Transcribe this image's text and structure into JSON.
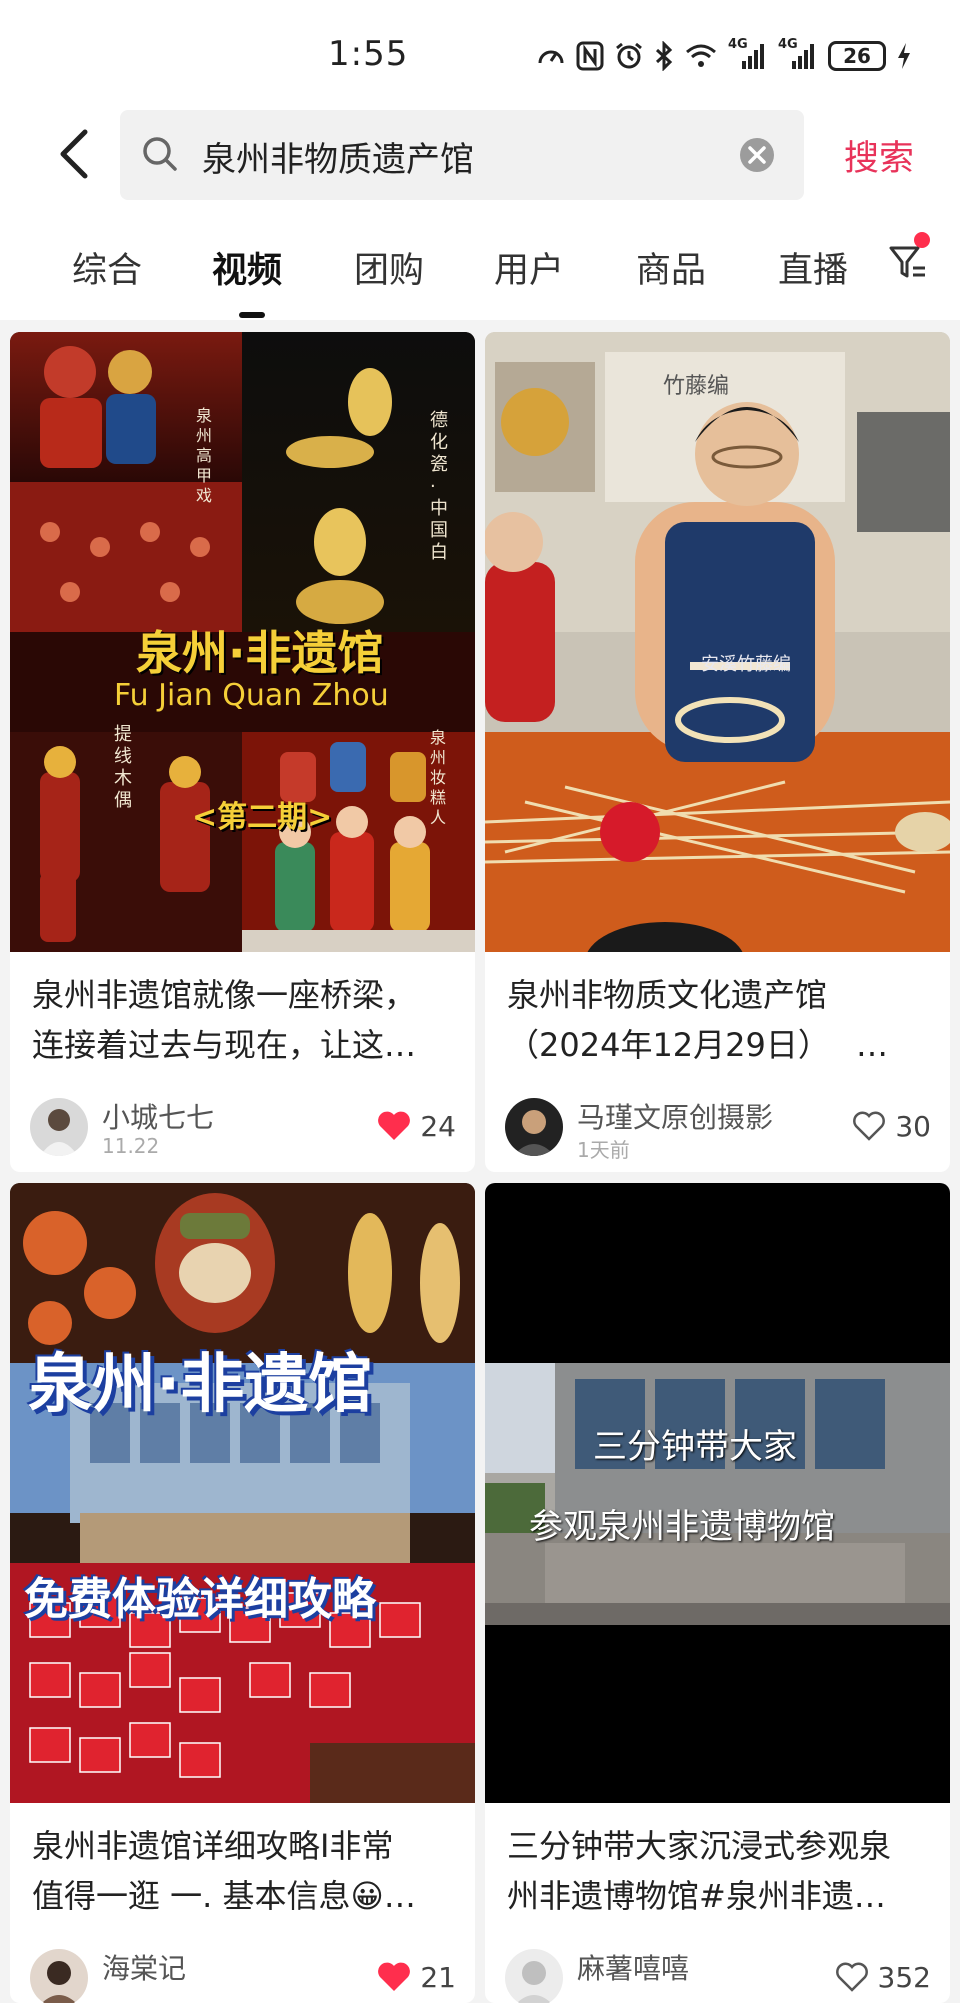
{
  "status_bar": {
    "time": "1:55",
    "battery": "26",
    "signal_labels": [
      "4G",
      "4G"
    ],
    "icons": [
      "speed-icon",
      "nfc-icon",
      "alarm-icon",
      "bluetooth-icon",
      "wifi-icon",
      "signal-icon",
      "signal-icon",
      "battery-icon",
      "charging-icon"
    ]
  },
  "search": {
    "query": "泉州非物质遗产馆",
    "submit_label": "搜索"
  },
  "tabs": [
    {
      "label": "综合"
    },
    {
      "label": "视频"
    },
    {
      "label": "团购"
    },
    {
      "label": "用户"
    },
    {
      "label": "商品"
    },
    {
      "label": "直播"
    }
  ],
  "active_tab": "视频",
  "colors": {
    "accent": "#e8335a",
    "like_red": "#ff2e4d"
  },
  "cards": [
    {
      "title_line1": "泉州非遗馆就像一座桥梁，",
      "title_line2": "连接着过去与现在，让这…",
      "cover_texts": {
        "main": "泉州·非遗馆",
        "sub": "Fu Jian Quan Zhou",
        "tag": "<第二期>",
        "side1": "德化瓷 · 中国白",
        "side2": "泉州高甲戏",
        "side3": "提线木偶",
        "side4": "泉州妆糕人"
      },
      "author": "小城七七",
      "date": "11.22",
      "likes": "24",
      "liked": true
    },
    {
      "title_line1": "泉州非物质文化遗产馆",
      "title_line2": "（2024年12月29日）　 …",
      "cover_texts": {
        "sign": "竹藤编",
        "apron": "安溪竹藤编"
      },
      "author": "马瑾文原创摄影",
      "date": "1天前",
      "likes": "30",
      "liked": false
    },
    {
      "title_line1": "泉州非遗馆详细攻略I非常",
      "title_line2": "值得一逛 一. 基本信息😀…",
      "cover_texts": {
        "main": "泉州·非遗馆",
        "banner": "免费体验详细攻略"
      },
      "author": "海棠记",
      "date": "",
      "likes": "21",
      "liked": true
    },
    {
      "title_line1": "三分钟带大家沉浸式参观泉",
      "title_line2": "州非遗博物馆#泉州非遗…",
      "cover_texts": {
        "line1": "三分钟带大家",
        "line2": "参观泉州非遗博物馆"
      },
      "author": "麻薯嘻嘻",
      "date": "",
      "likes": "352",
      "liked": false
    }
  ]
}
